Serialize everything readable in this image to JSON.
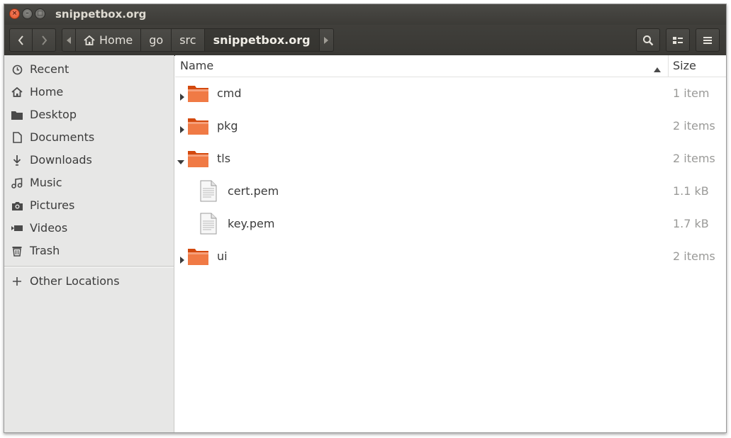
{
  "window": {
    "title": "snippetbox.org",
    "buttons": {
      "close": "×",
      "minimize": "–",
      "maximize": "□"
    }
  },
  "toolbar": {
    "back_icon": "chevron-left-icon",
    "forward_icon": "chevron-right-icon",
    "path": [
      {
        "label": "Home",
        "icon": "home-icon"
      },
      {
        "label": "go"
      },
      {
        "label": "src"
      },
      {
        "label": "snippetbox.org",
        "active": true
      }
    ],
    "search_icon": "search-icon",
    "view_icon": "list-view-icon",
    "menu_icon": "hamburger-menu-icon"
  },
  "sidebar": {
    "items": [
      {
        "label": "Recent",
        "icon": "clock-icon"
      },
      {
        "label": "Home",
        "icon": "home-icon"
      },
      {
        "label": "Desktop",
        "icon": "folder-icon"
      },
      {
        "label": "Documents",
        "icon": "document-icon"
      },
      {
        "label": "Downloads",
        "icon": "download-icon"
      },
      {
        "label": "Music",
        "icon": "music-icon"
      },
      {
        "label": "Pictures",
        "icon": "camera-icon"
      },
      {
        "label": "Videos",
        "icon": "video-icon"
      },
      {
        "label": "Trash",
        "icon": "trash-icon"
      }
    ],
    "other": {
      "label": "Other Locations",
      "icon": "plus-icon"
    }
  },
  "list": {
    "columns": {
      "name": "Name",
      "size": "Size"
    },
    "rows": [
      {
        "name": "cmd",
        "size": "1 item",
        "type": "folder",
        "expander": "collapsed"
      },
      {
        "name": "pkg",
        "size": "2 items",
        "type": "folder",
        "expander": "collapsed"
      },
      {
        "name": "tls",
        "size": "2 items",
        "type": "folder",
        "expander": "expanded"
      },
      {
        "name": "cert.pem",
        "size": "1.1 kB",
        "type": "file"
      },
      {
        "name": "key.pem",
        "size": "1.7 kB",
        "type": "file"
      },
      {
        "name": "ui",
        "size": "2 items",
        "type": "folder",
        "expander": "collapsed"
      }
    ]
  },
  "colors": {
    "titlebar": "#3c3b37",
    "close_button": "#e0531f",
    "sidebar": "#e7e7e6",
    "folder": "#e95420"
  }
}
